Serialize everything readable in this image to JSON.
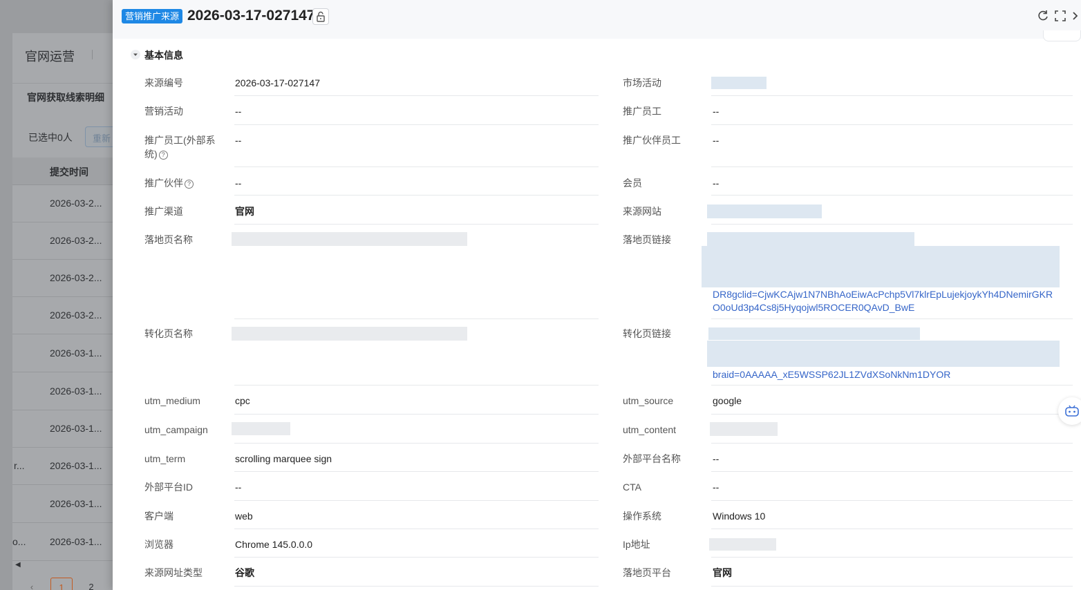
{
  "background": {
    "title": "官网运营",
    "subtitle": "官网获取线索明细",
    "selected": "已选中0人",
    "reset_button": "重新",
    "column_header": "提交时间",
    "rows": [
      {
        "left": "",
        "time": "2026-03-2..."
      },
      {
        "left": "",
        "time": "2026-03-2..."
      },
      {
        "left": "",
        "time": "2026-03-2..."
      },
      {
        "left": "",
        "time": "2026-03-2..."
      },
      {
        "left": "",
        "time": "2026-03-1..."
      },
      {
        "left": "",
        "time": "2026-03-1..."
      },
      {
        "left": "",
        "time": "2026-03-1..."
      },
      {
        "left": "r...",
        "time": "2026-03-1..."
      },
      {
        "left": "",
        "time": "2026-03-1..."
      },
      {
        "left": "o...",
        "time": "2026-03-1..."
      }
    ],
    "pager": [
      "1",
      "2"
    ]
  },
  "drawer": {
    "tag": "营销推广来源",
    "title": "2026-03-17-027147",
    "section_title": "基本信息",
    "fields": {
      "source_no_label": "来源编号",
      "source_no": "2026-03-17-027147",
      "market_activity_label": "市场活动",
      "marketing_activity_label": "营销活动",
      "marketing_activity": "--",
      "promoter_label": "推广员工",
      "promoter": "--",
      "promoter_ext_label_1": "推广员工(外部系",
      "promoter_ext_label_2": "统)",
      "promoter_ext": "--",
      "partner_staff_label": "推广伙伴员工",
      "partner_staff": "--",
      "partner_label": "推广伙伴",
      "partner": "--",
      "member_label": "会员",
      "member": "--",
      "channel_label": "推广渠道",
      "channel": "官网",
      "source_site_label": "来源网站",
      "landing_name_label": "落地页名称",
      "landing_link_label": "落地页链接",
      "landing_link_1": "DR8gclid=CjwKCAjw1N7NBhAoEiwAcPchp5Vl7klrEpLujekjoykYh4DNemirGKR",
      "landing_link_2": "O0oUd3p4Cs8j5Hyqojwl5ROCER0QAvD_BwE",
      "conv_name_label": "转化页名称",
      "conv_link_label": "转化页链接",
      "conv_link_1": "braid=0AAAAA_xE5WSSP62JL1ZVdXSoNkNm1DYOR",
      "utm_medium_label": "utm_medium",
      "utm_medium": "cpc",
      "utm_source_label": "utm_source",
      "utm_source": "google",
      "utm_campaign_label": "utm_campaign",
      "utm_content_label": "utm_content",
      "utm_term_label": "utm_term",
      "utm_term": "scrolling marquee sign",
      "ext_platform_name_label": "外部平台名称",
      "ext_platform_name": "--",
      "ext_platform_id_label": "外部平台ID",
      "ext_platform_id": "--",
      "cta_label": "CTA",
      "cta": "--",
      "client_label": "客户端",
      "client": "web",
      "os_label": "操作系统",
      "os": "Windows 10",
      "browser_label": "浏览器",
      "browser": "Chrome 145.0.0.0",
      "ip_label": "Ip地址",
      "source_url_type_label": "来源网址类型",
      "source_url_type": "谷歌",
      "landing_platform_label": "落地页平台",
      "landing_platform": "官网"
    }
  },
  "icons": [
    "lock-icon",
    "refresh-icon",
    "fullscreen-icon",
    "chevron-right-icon",
    "caret-down-icon",
    "help-icon",
    "robot-icon"
  ]
}
